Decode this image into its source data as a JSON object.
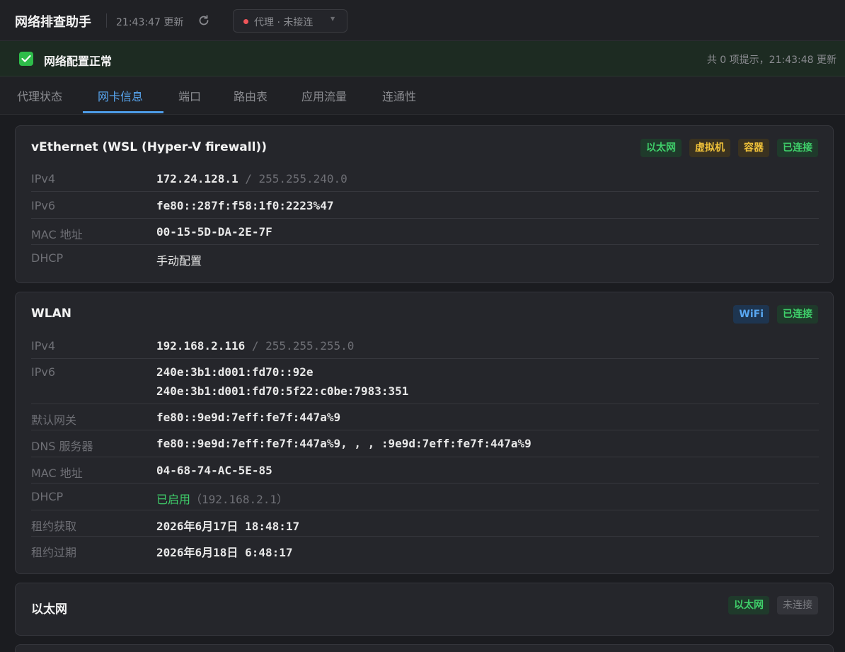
{
  "header": {
    "title": "网络排查助手",
    "update_time": "21:43:47 更新",
    "proxy_status": "代理 · 未接连"
  },
  "banner": {
    "title": "网络配置正常",
    "summary": "共 0 项提示，21:43:48 更新"
  },
  "tabs": [
    "代理状态",
    "网卡信息",
    "端口",
    "路由表",
    "应用流量",
    "连通性"
  ],
  "active_tab": "网卡信息",
  "labels": {
    "ipv4": "IPv4",
    "ipv6": "IPv6",
    "mac": "MAC 地址",
    "dhcp": "DHCP",
    "gateway": "默认网关",
    "dns": "DNS 服务器",
    "lease_obtained": "租约获取",
    "lease_expires": "租约过期",
    "slash": "/"
  },
  "adapters": [
    {
      "name": "vEthernet (WSL (Hyper-V firewall))",
      "badges": [
        "以太网",
        "虚拟机",
        "容器",
        "已连接"
      ],
      "ipv4": "172.24.128.1",
      "mask": "255.255.240.0",
      "ipv6": [
        "fe80::287f:f58:1f0:2223%47"
      ],
      "mac": "00-15-5D-DA-2E-7F",
      "dhcp": "手动配置"
    },
    {
      "name": "WLAN",
      "badges": [
        "WiFi",
        "已连接"
      ],
      "ipv4": "192.168.2.116",
      "mask": "255.255.255.0",
      "ipv6": [
        "240e:3b1:d001:fd70::92e",
        "240e:3b1:d001:fd70:5f22:c0be:7983:351"
      ],
      "gateway": "fe80::9e9d:7eff:fe7f:447a%9",
      "dns": "fe80::9e9d:7eff:fe7f:447a%9, , , :9e9d:7eff:fe7f:447a%9",
      "mac": "04-68-74-AC-5E-85",
      "dhcp_status": "已启用",
      "dhcp_server": "（192.168.2.1）",
      "lease_obtained": "2026年6月17日 18:48:17",
      "lease_expires": "2026年6月18日 6:48:17"
    },
    {
      "name": "以太网",
      "badges": [
        "以太网",
        "未连接"
      ]
    }
  ],
  "colors": {
    "background": "#1b1c20",
    "accent": "#58a6f0",
    "ok_green": "#3fcf6a",
    "warn_yellow": "#f0c23a",
    "error_red": "#f0555a"
  }
}
